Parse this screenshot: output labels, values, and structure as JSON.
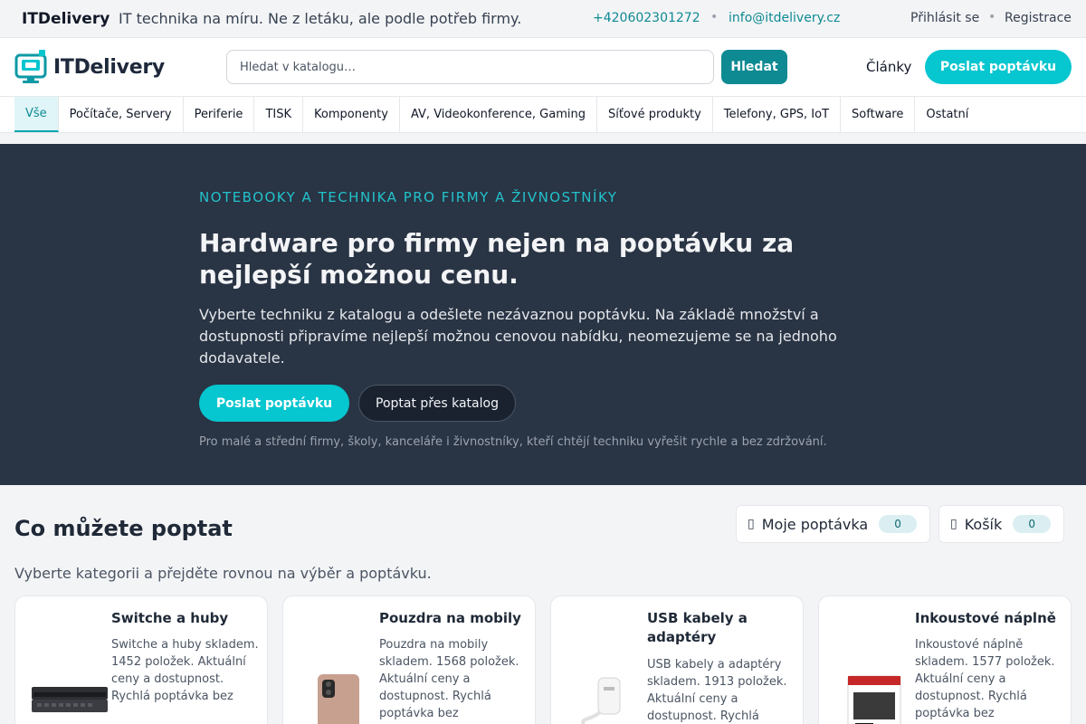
{
  "topbar": {
    "brand": "ITDelivery",
    "tagline": "IT technika na míru. Ne z letáku, ale podle potřeb firmy.",
    "phone": "+420602301272",
    "separator": "•",
    "email": "info@itdelivery.cz",
    "login": "Přihlásit se",
    "register": "Registrace"
  },
  "header": {
    "logo_text": "ITDelivery",
    "search_placeholder": "Hledat v katalogu…",
    "search_button": "Hledat",
    "articles_link": "Články",
    "send_request_button": "Poslat poptávku"
  },
  "categories": [
    "Vše",
    "Počítače, Servery",
    "Periferie",
    "TISK",
    "Komponenty",
    "AV, Videokonference, Gaming",
    "Síťové produkty",
    "Telefony, GPS, IoT",
    "Software",
    "Ostatní"
  ],
  "hero": {
    "kicker": "NOTEBOOKY A TECHNIKA PRO FIRMY A ŽIVNOSTNÍKY",
    "title": "Hardware pro firmy nejen na poptávku za nejlepší možnou cenu.",
    "lead": "Vyberte techniku z katalogu a odešlete nezávaznou poptávku. Na základě množství a dostupnosti připravíme nejlepší možnou cenovou nabídku, neomezujeme se na jednoho dodavatele.",
    "primary_button": "Poslat poptávku",
    "secondary_button": "Poptat přes katalog",
    "note": "Pro malé a střední firmy, školy, kanceláře i živnostníky, kteří chtějí techniku vyřešit rychle a bez zdržování."
  },
  "section": {
    "title": "Co můžete poptat",
    "subtitle": "Vyberte kategorii a přejděte rovnou na výběr a poptávku.",
    "my_request_label": "Moje poptávka",
    "my_request_count": "0",
    "cart_label": "Košík",
    "cart_count": "0"
  },
  "cards": [
    {
      "title": "Switche a huby",
      "desc": "Switche a huby skladem. 1452 položek. Aktuální ceny a dostupnost. Rychlá poptávka bez"
    },
    {
      "title": "Pouzdra na mobily",
      "desc": "Pouzdra na mobily skladem. 1568 položek. Aktuální ceny a dostupnost. Rychlá poptávka bez"
    },
    {
      "title": "USB kabely a adaptéry",
      "desc": "USB kabely a adaptéry skladem. 1913 položek. Aktuální ceny a dostupnost. Rychlá"
    },
    {
      "title": "Inkoustové náplně",
      "desc": "Inkoustové náplně skladem. 1577 položek. Aktuální ceny a dostupnost. Rychlá poptávka bez"
    }
  ],
  "colors": {
    "accent": "#06c6cf",
    "accent_dark": "#0e8a93",
    "hero_bg": "#293444"
  }
}
